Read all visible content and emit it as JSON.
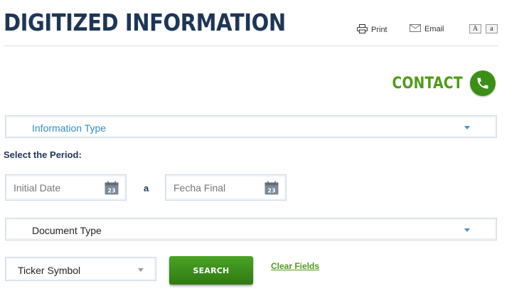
{
  "header": {
    "title": "DIGITIZED INFORMATION",
    "print_label": "Print",
    "email_label": "Email",
    "font_large": "A",
    "font_small": "a"
  },
  "contact": {
    "label": "CONTACT",
    "icon": "phone-icon"
  },
  "form": {
    "information_type": {
      "label": "Information Type",
      "color": "#2f8ec7"
    },
    "period_label": "Select the Period:",
    "initial_date": {
      "placeholder": "Initial Date",
      "calendar_day": "23"
    },
    "separator": "a",
    "final_date": {
      "placeholder": "Fecha Final",
      "calendar_day": "23"
    },
    "document_type": {
      "label": "Document Type"
    },
    "ticker": {
      "label": "Ticker Symbol"
    },
    "search_label": "SEARCH",
    "clear_label": "Clear Fields"
  },
  "colors": {
    "title": "#1e3656",
    "accent_green": "#4f9a17",
    "button_green": "#3c8f16",
    "link_blue": "#2f8ec7"
  }
}
